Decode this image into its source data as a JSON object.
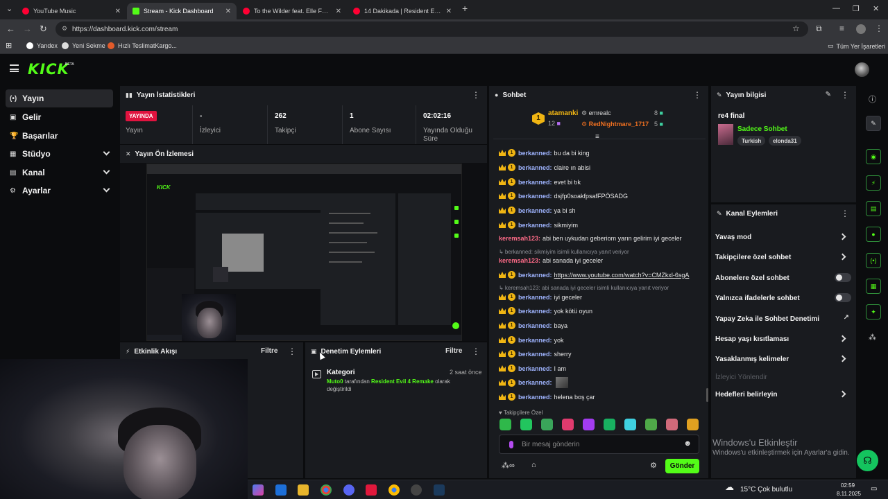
{
  "browser": {
    "tabs": [
      {
        "title": "YouTube Music",
        "color": "#ff0033"
      },
      {
        "title": "Stream - Kick Dashboard",
        "color": "#53fc18"
      },
      {
        "title": "To the Wilder feat. Elle Fanning",
        "color": "#ff0033"
      },
      {
        "title": "14 Dakikada | Resident Evil 6 LE",
        "color": "#ff0033"
      }
    ],
    "url": "https://dashboard.kick.com/stream",
    "bookmarks": [
      "Yandex",
      "Yeni Sekme",
      "Hızlı TeslimatKargo..."
    ],
    "all_bookmarks": "Tüm Yer İşaretleri"
  },
  "brand": {
    "logo": "KICK",
    "beta": "BETA",
    "accent": "#53fc18"
  },
  "sidebar": {
    "items": [
      {
        "label": "Yayın",
        "icon": "(•)"
      },
      {
        "label": "Gelir",
        "icon": "▣"
      },
      {
        "label": "Başarılar",
        "icon": "🏆"
      },
      {
        "label": "Stüdyo",
        "icon": "▦"
      },
      {
        "label": "Kanal",
        "icon": "▤"
      },
      {
        "label": "Ayarlar",
        "icon": "⚙"
      }
    ]
  },
  "stats": {
    "title": "Yayın İstatistikleri",
    "live_badge": "YAYINDA",
    "live_label": "Yayın",
    "viewers_value": "-",
    "viewers_label": "İzleyici",
    "followers_value": "262",
    "followers_label": "Takipçi",
    "subs_value": "1",
    "subs_label": "Abone Sayısı",
    "uptime_value": "02:02:16",
    "uptime_label_1": "Yayında Olduğu",
    "uptime_label_2": "Süre"
  },
  "preview": {
    "title": "Yayın Ön İzlemesi"
  },
  "activity": {
    "title": "Etkinlik Akışı",
    "filter": "Filtre"
  },
  "moderation": {
    "title": "Denetim Eylemleri",
    "filter": "Filtre",
    "item_title": "Kategori",
    "item_time": "2 saat önce",
    "item_user": "Muto0",
    "item_mid": " tarafından ",
    "item_game": "Resident Evil 4 Remake",
    "item_end": " olarak",
    "item_line2": "değiştirildi"
  },
  "chat": {
    "title": "Sohbet",
    "top": {
      "first_rank": "1",
      "first_name": "atamanki",
      "first_count": "12",
      "second_name": "emrealc",
      "second_count": "8",
      "third_name": "RedNightmare_1717",
      "third_count": "5"
    },
    "messages": [
      {
        "user": "berkanned:",
        "text": "bu da bi king"
      },
      {
        "user": "berkanned:",
        "text": "claire ın abisi"
      },
      {
        "user": "berkanned:",
        "text": "evet bi tık"
      },
      {
        "user": "berkanned:",
        "text": "dsjfp0soakfpsafFPÖSADG"
      },
      {
        "user": "berkanned:",
        "text": "ya bi sh"
      },
      {
        "user": "berkanned:",
        "text": "sikmiyim"
      }
    ],
    "keremsah_1": {
      "user": "keremsah123:",
      "text": "abi ben uykudan geberiom yarın gelirim iyi geceler"
    },
    "reply_1": "↳ berkanned: sikmiyim isimli kullanıcıya yanıt veriyor",
    "keremsah_2": {
      "user": "keremsah123:",
      "text": "abi sanada iyi geceler"
    },
    "link_msg": {
      "user": "berkanned:",
      "text": "https://www.youtube.com/watch?v=CMZkxl-6sgA"
    },
    "reply_2": "↳ keremsah123: abi sanada iyi geceler isimli kullanıcıya yanıt veriyor",
    "messages_2": [
      {
        "user": "berkanned:",
        "text": "iyi geceler"
      },
      {
        "user": "berkanned:",
        "text": "yok kötü oyun"
      },
      {
        "user": "berkanned:",
        "text": "baya"
      },
      {
        "user": "berkanned:",
        "text": "yok"
      },
      {
        "user": "berkanned:",
        "text": "sherry"
      },
      {
        "user": "berkanned:",
        "text": "I am"
      }
    ],
    "emote_msg_user": "berkanned:",
    "last_msg": {
      "user": "berkanned:",
      "text": "helena boş çar"
    },
    "followers_only": "♥ Takipçilere Özel",
    "emote_colors": [
      "#2fb84a",
      "#22c55e",
      "#3aa55a",
      "#e03b6e",
      "#a23cf0",
      "#18b060",
      "#3fd0e0",
      "#4fa848",
      "#d06a7a",
      "#e0a020"
    ],
    "input_placeholder": "Bir mesaj gönderin",
    "send": "Gönder"
  },
  "stream_info": {
    "title": "Yayın bilgisi",
    "stream_title": "re4 final",
    "game": "Sadece Sohbet",
    "tags": [
      "Turkish",
      "elonda31"
    ]
  },
  "channel_actions": {
    "title": "Kanal Eylemleri",
    "rows": [
      {
        "label": "Yavaş mod",
        "kind": "arrow"
      },
      {
        "label": "Takipçilere özel sohbet",
        "kind": "arrow"
      },
      {
        "label": "Abonelere özel sohbet",
        "kind": "toggle"
      },
      {
        "label": "Yalnızca ifadelerle sohbet",
        "kind": "toggle"
      },
      {
        "label": "Yapay Zeka ile Sohbet Denetimi",
        "kind": "external"
      },
      {
        "label": "Hesap yaşı kısıtlaması",
        "kind": "arrow"
      },
      {
        "label": "Yasaklanmış kelimeler",
        "kind": "arrow"
      },
      {
        "label": "İzleyici Yönlendir",
        "kind": "disabled"
      },
      {
        "label": "Hedefleri belirleyin",
        "kind": "arrow"
      }
    ]
  },
  "windows": {
    "activate_title": "Windows'u Etkinleştir",
    "activate_sub": "Windows'u etkinleştirmek için Ayarlar'a gidin.",
    "weather": "15°C  Çok bulutlu",
    "time": "02:59",
    "date": "8.11.2025"
  }
}
